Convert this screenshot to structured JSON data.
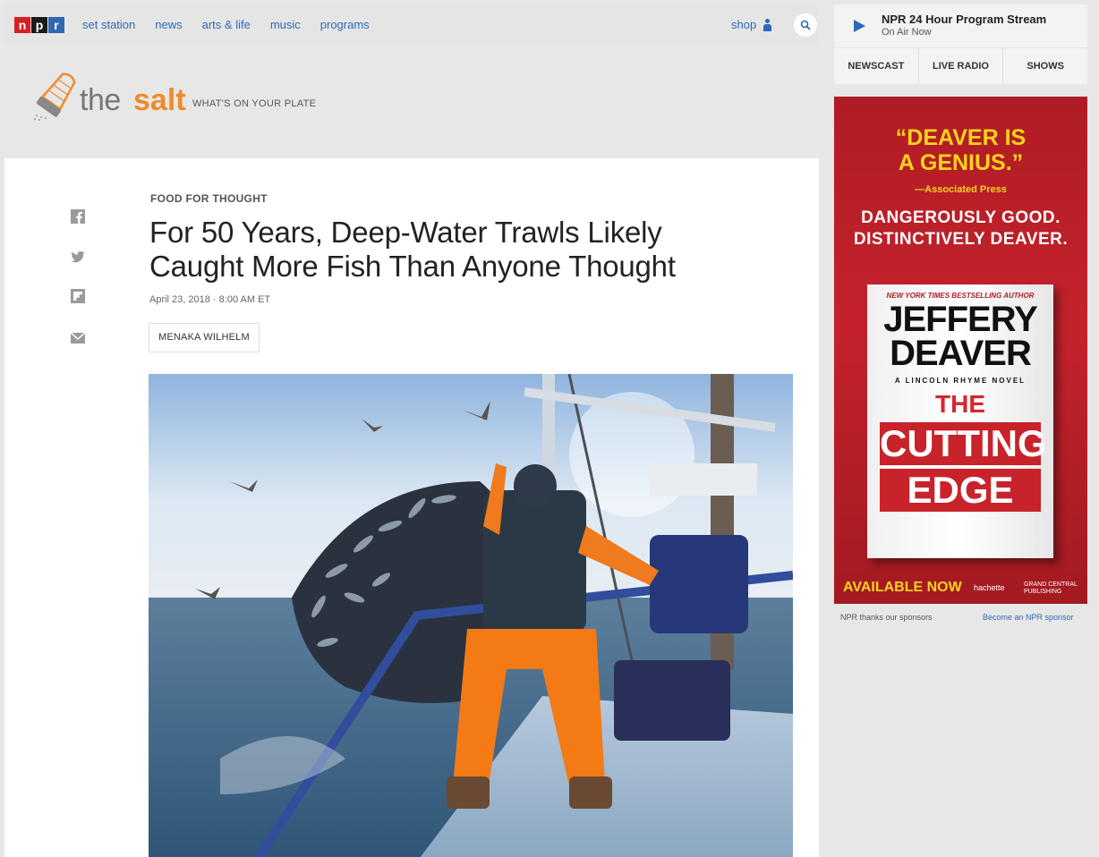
{
  "nav": {
    "logo": [
      "n",
      "p",
      "r"
    ],
    "links": [
      "set station",
      "news",
      "arts & life",
      "music",
      "programs"
    ],
    "shop": "shop"
  },
  "blog": {
    "the": "the",
    "name": "salt",
    "tagline": "WHAT'S ON YOUR PLATE"
  },
  "article": {
    "kicker": "FOOD FOR THOUGHT",
    "headline_line1": "For 50 Years, Deep-Water Trawls Likely",
    "headline_line2": "Caught More Fish Than Anyone Thought",
    "date": "April 23, 2018 · 8:00 AM ET",
    "byline": "MENAKA WILHELM"
  },
  "player": {
    "title": "NPR 24 Hour Program Stream",
    "status": "On Air Now",
    "tabs": [
      "NEWSCAST",
      "LIVE RADIO",
      "SHOWS"
    ]
  },
  "ad": {
    "quote_line1": "“DEAVER IS",
    "quote_line2": "A GENIUS.”",
    "quote_source": "—Associated Press",
    "tag_line1": "DANGEROUSLY GOOD.",
    "tag_line2": "DISTINCTIVELY DEAVER.",
    "book_banner": "NEW YORK TIMES BESTSELLING AUTHOR",
    "author_first": "JEFFERY",
    "author_last": "DEAVER",
    "series": "A LINCOLN RHYME NOVEL",
    "title_1": "THE",
    "title_2": "CUTTING",
    "title_3": "EDGE",
    "cta": "AVAILABLE NOW",
    "publisher_1": "hachette",
    "publisher_2a": "GRAND CENTRAL",
    "publisher_2b": "PUBLISHING"
  },
  "sponsor": {
    "thanks": "NPR thanks our sponsors",
    "become": "Become an NPR sponsor"
  },
  "colors": {
    "npr_red": "#d62021",
    "npr_blue": "#3267b1",
    "link_blue": "#2f6ab8",
    "salt_orange": "#f08b2b",
    "ad_red": "#c4222b",
    "ad_yellow": "#f7d31e"
  }
}
